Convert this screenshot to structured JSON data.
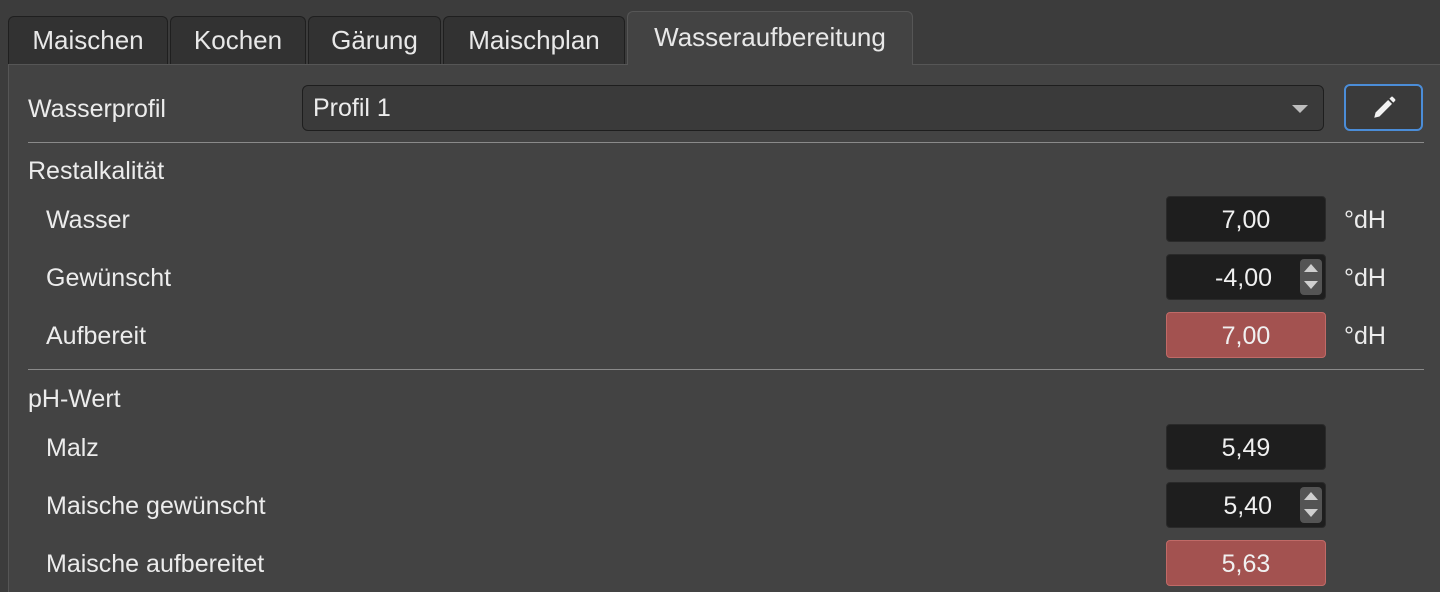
{
  "tabs": [
    {
      "label": "Maischen"
    },
    {
      "label": "Kochen"
    },
    {
      "label": "Gärung"
    },
    {
      "label": "Maischplan"
    },
    {
      "label": "Wasseraufbereitung"
    }
  ],
  "active_tab": "Wasseraufbereitung",
  "wasserprofil": {
    "label": "Wasserprofil",
    "selected": "Profil 1",
    "edit_icon": "pencil-icon"
  },
  "restalkalitaet": {
    "title": "Restalkalität",
    "unit": "°dH",
    "rows": [
      {
        "label": "Wasser",
        "value": "7,00"
      },
      {
        "label": "Gewünscht",
        "value": "-4,00"
      },
      {
        "label": "Aufbereit",
        "value": "7,00"
      }
    ]
  },
  "ph": {
    "title": "pH-Wert",
    "rows": [
      {
        "label": "Malz",
        "value": "5,49"
      },
      {
        "label": "Maische gewünscht",
        "value": "5,40"
      },
      {
        "label": "Maische aufbereitet",
        "value": "5,63"
      }
    ]
  },
  "colors": {
    "background": "#434343",
    "highlight_red": "#a35250",
    "focus_blue": "#4b8dd8"
  }
}
